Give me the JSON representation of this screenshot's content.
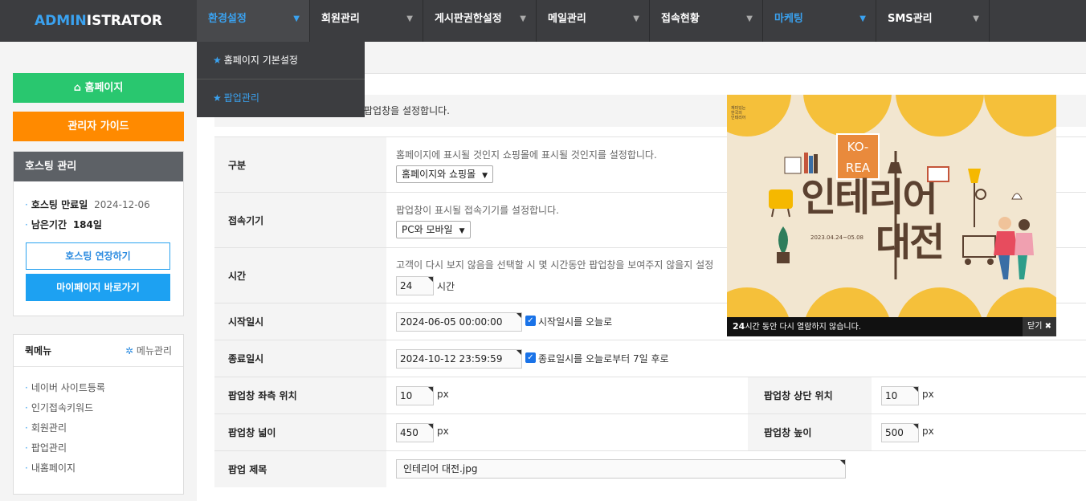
{
  "header": {
    "logo_a": "ADMIN",
    "logo_b": "ISTRATOR",
    "nav": [
      "환경설정",
      "회원관리",
      "게시판권한설정",
      "메일관리",
      "접속현황",
      "마케팅",
      "SMS관리"
    ]
  },
  "dropdown": {
    "items": [
      "홈페이지 기본설정",
      "팝업관리"
    ]
  },
  "sidebar": {
    "home_label": "홈페이지",
    "guide_label": "관리자 가이드",
    "hosting": {
      "title": "호스팅 관리",
      "expire_label": "호스팅 만료일",
      "expire_value": "2024-12-06",
      "remaining_label": "남은기간",
      "remaining_value": "184일",
      "extend_label": "호스팅 연장하기",
      "mypage_label": "마이페이지 바로가기"
    },
    "quick": {
      "title": "퀵메뉴",
      "manage_label": "메뉴관리",
      "items": [
        "네이버 사이트등록",
        "인기접속키워드",
        "회원관리",
        "팝업관리",
        "내홈페이지"
      ]
    }
  },
  "main": {
    "desc": "팝업창을 설정합니다.",
    "rows": {
      "type": {
        "label": "구분",
        "help": "홈페이지에 표시될 것인지 쇼핑몰에 표시될 것인지를 설정합니다.",
        "value": "홈페이지와 쇼핑몰"
      },
      "device": {
        "label": "접속기기",
        "help": "팝업창이 표시될 접속기기를 설정합니다.",
        "value": "PC와 모바일"
      },
      "time": {
        "label": "시간",
        "help": "고객이 다시 보지 않음을 선택할 시 몇 시간동안 팝업창을 보여주지 않을지 설정",
        "value": "24",
        "unit": "시간"
      },
      "start": {
        "label": "시작일시",
        "value": "2024-06-05 00:00:00",
        "check": "시작일시를 오늘로"
      },
      "end": {
        "label": "종료일시",
        "value": "2024-10-12 23:59:59",
        "check": "종료일시를 오늘로부터 7일 후로"
      },
      "left": {
        "label": "팝업창 좌측 위치",
        "value": "10",
        "unit": "px"
      },
      "top": {
        "label": "팝업창 상단 위치",
        "value": "10",
        "unit": "px"
      },
      "width": {
        "label": "팝업창 넓이",
        "value": "450",
        "unit": "px"
      },
      "height": {
        "label": "팝업창 높이",
        "value": "500",
        "unit": "px"
      },
      "title": {
        "label": "팝업 제목",
        "value": "인테리어 대전.jpg"
      }
    }
  },
  "popup": {
    "korea_1": "KO-",
    "korea_2": "REA",
    "big_1": "인테리어",
    "big_2": "대전",
    "date": "2023.04.24~05.08",
    "corner": "재미있는\n한국의\n인테리어",
    "footer_hours": "24",
    "footer_text": "시간 동안 다시 열람하지 않습니다.",
    "close_label": "닫기 ✖"
  },
  "colors": {
    "accent": "#3aa2f0",
    "green": "#29c76f",
    "orange": "#ff8a00",
    "topbar": "#3c3d40"
  }
}
